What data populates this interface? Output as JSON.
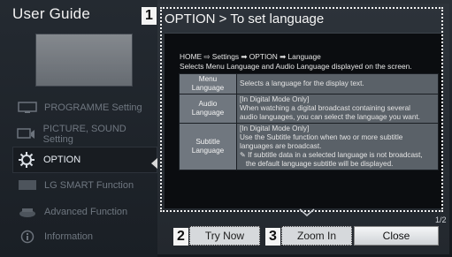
{
  "guide": {
    "title": "User Guide",
    "menu": [
      {
        "label": "PROGRAMME Setting",
        "icon": "tv-icon",
        "active": false
      },
      {
        "label": "PICTURE, SOUND Setting",
        "icon": "picture-sound-icon",
        "active": false
      },
      {
        "label": "OPTION",
        "icon": "gear-icon",
        "active": true
      },
      {
        "label": "LG SMART Function",
        "icon": "smart-icon",
        "active": false
      },
      {
        "label": "Advanced Function",
        "icon": "advanced-icon",
        "active": false
      },
      {
        "label": "Information",
        "icon": "info-icon",
        "active": false
      }
    ]
  },
  "popup": {
    "badges": [
      "1",
      "2",
      "3"
    ],
    "title": "OPTION > To set language",
    "path": "HOME ⇨ Settings ➡ OPTION ➡ Language",
    "description": "Selects Menu Language and Audio Language displayed on the screen.",
    "table": [
      {
        "key": "Menu Language",
        "lines": [
          "Selects a language for the display text."
        ]
      },
      {
        "key": "Audio Language",
        "lines": [
          "[In Digital Mode Only]",
          "When watching a digital broadcast containing several",
          "audio languages, you can select the language you want."
        ]
      },
      {
        "key": "Subtitle Language",
        "lines": [
          "[In Digital Mode Only]",
          "Use the Subtitle function when two or more subtitle",
          "languages are broadcast.",
          "✎ If subtitle data in a selected language is not broadcast,",
          "   the default language subtitle will be displayed."
        ]
      }
    ],
    "page_indicator": "1/2",
    "buttons": {
      "try_now": "Try Now",
      "zoom_in": "Zoom In",
      "close": "Close"
    }
  },
  "colors": {
    "accent_border": "#f2f2f2",
    "table_key_bg": "#70777f",
    "table_value_bg": "#5a6168"
  }
}
